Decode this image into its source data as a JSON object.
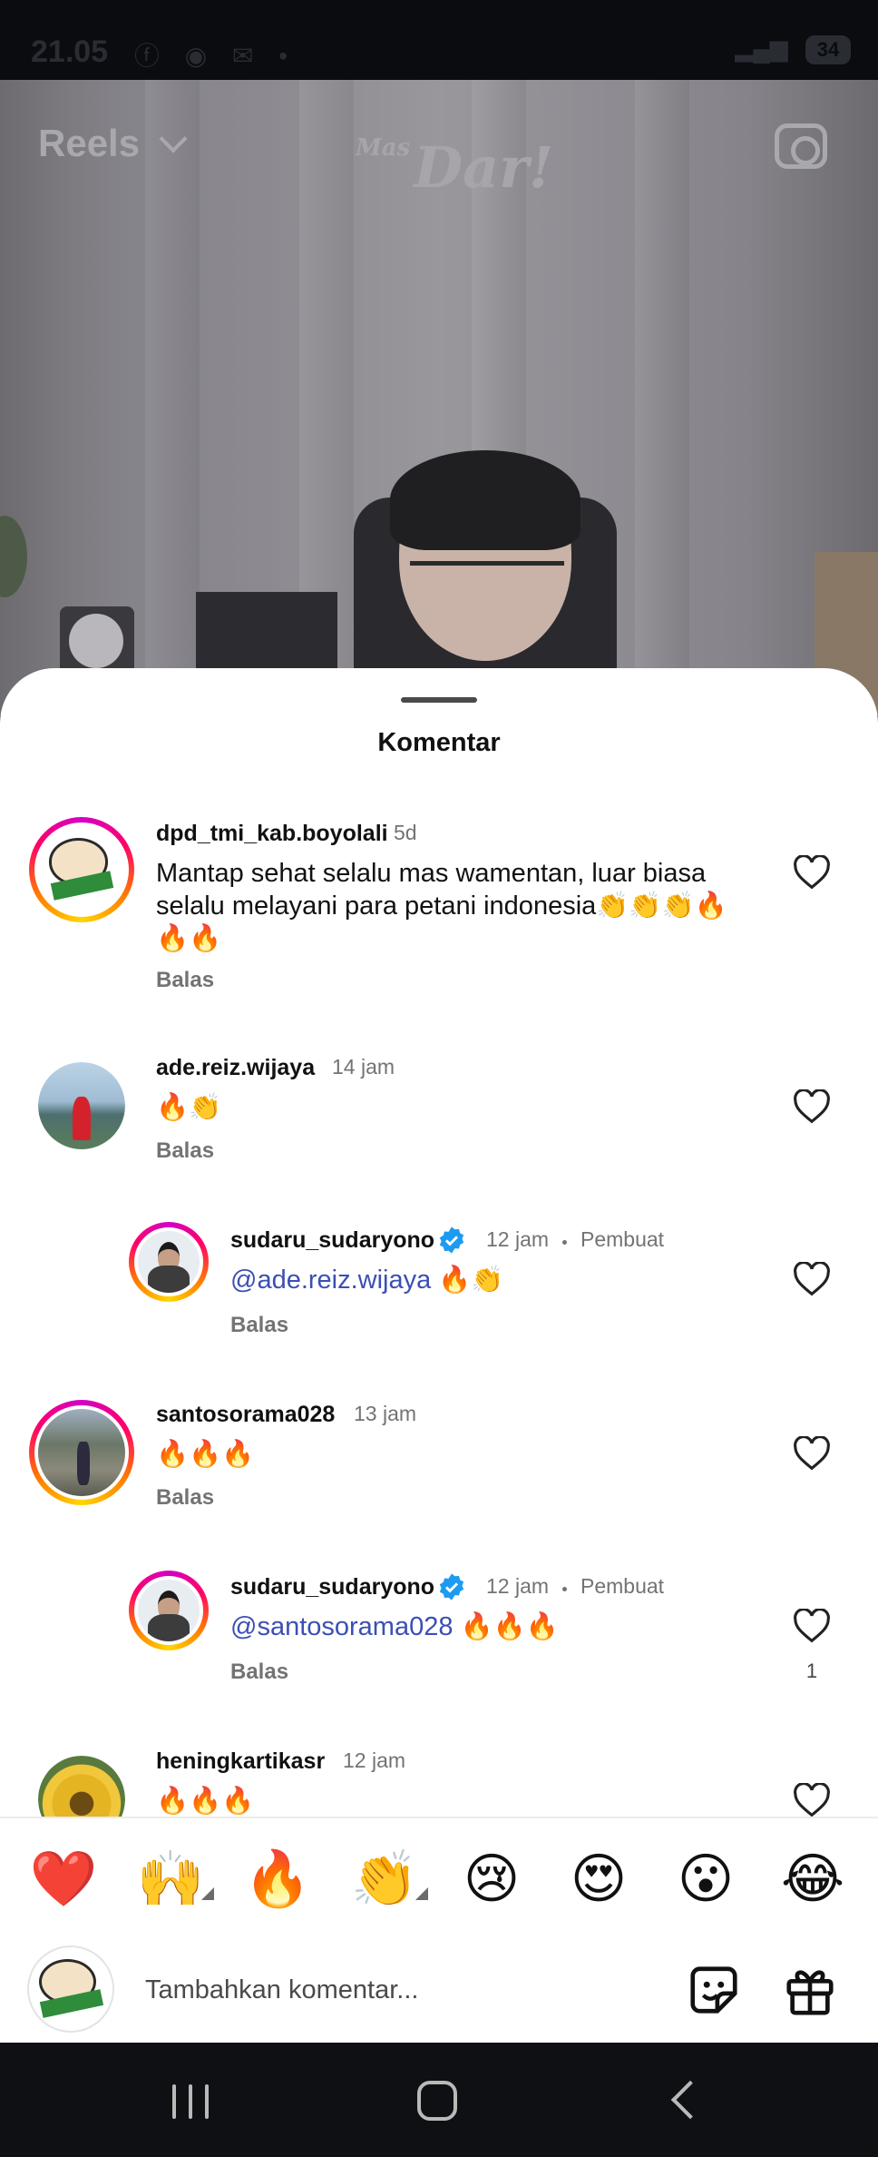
{
  "status_bar": {
    "time": "21.05",
    "icons": [
      "facebook-icon",
      "whatsapp-icon",
      "mail-icon",
      "dot-icon"
    ],
    "battery": "34"
  },
  "reel": {
    "title": "Reels",
    "logo_small": "Mas",
    "logo": "Dar!"
  },
  "sheet": {
    "title": "Komentar"
  },
  "comments": [
    {
      "username": "dpd_tmi_kab.boyolali",
      "time": "5d",
      "text_line1": "Mantap sehat selalu mas wamentan, luar biasa",
      "text_line2": "selalu melayani para petani indonesia👏👏👏🔥",
      "text_line3": "🔥🔥",
      "reply": "Balas"
    },
    {
      "username": "ade.reiz.wijaya",
      "time": "14 jam",
      "text": "🔥👏",
      "reply": "Balas"
    },
    {
      "username": "sudaru_sudaryono",
      "time": "12 jam",
      "creator": "Pembuat",
      "mention": "@ade.reiz.wijaya",
      "text": " 🔥👏",
      "reply": "Balas"
    },
    {
      "username": "santosorama028",
      "time": "13 jam",
      "text": "🔥🔥🔥",
      "reply": "Balas"
    },
    {
      "username": "sudaru_sudaryono",
      "time": "12 jam",
      "creator": "Pembuat",
      "mention": "@santosorama028",
      "text": " 🔥🔥🔥",
      "reply": "Balas",
      "likes": "1"
    },
    {
      "username": "heningkartikasr",
      "time": "12 jam",
      "text": "🔥🔥🔥"
    }
  ],
  "emoji_bar": [
    "❤️",
    "🙌",
    "🔥",
    "👏",
    "😢",
    "😍",
    "😮",
    "😂"
  ],
  "input": {
    "placeholder": "Tambahkan komentar..."
  },
  "colors": {
    "mention": "#3b4fb5",
    "verified": "#1d9bf0",
    "secondary_text": "#737373"
  }
}
